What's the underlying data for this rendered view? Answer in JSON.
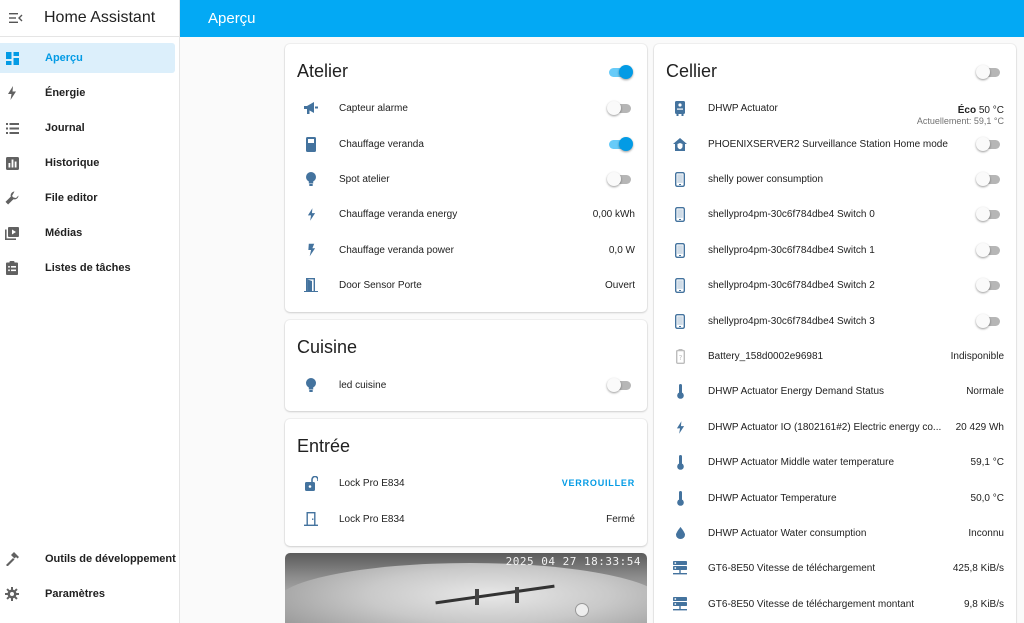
{
  "app": {
    "title": "Home Assistant"
  },
  "header": {
    "title": "Aperçu"
  },
  "sidebar": {
    "items": [
      {
        "label": "Aperçu",
        "icon": "dashboard-icon",
        "active": true
      },
      {
        "label": "Énergie",
        "icon": "lightning-icon"
      },
      {
        "label": "Journal",
        "icon": "list-icon"
      },
      {
        "label": "Historique",
        "icon": "chart-bar-icon"
      },
      {
        "label": "File editor",
        "icon": "wrench-icon"
      },
      {
        "label": "Médias",
        "icon": "media-play-icon"
      },
      {
        "label": "Listes de tâches",
        "icon": "clipboard-list-icon"
      }
    ],
    "bottom": [
      {
        "label": "Outils de développement",
        "icon": "hammer-icon"
      },
      {
        "label": "Paramètres",
        "icon": "gear-icon"
      }
    ]
  },
  "cards": {
    "atelier": {
      "title": "Atelier",
      "toggle_on": true,
      "rows": [
        {
          "name": "Capteur alarme",
          "icon": "bullhorn-icon",
          "toggle": false
        },
        {
          "name": "Chauffage veranda",
          "icon": "heater-icon",
          "toggle": true
        },
        {
          "name": "Spot atelier",
          "icon": "lightbulb-icon",
          "toggle": false
        },
        {
          "name": "Chauffage veranda energy",
          "icon": "lightning-icon",
          "value": "0,00 kWh"
        },
        {
          "name": "Chauffage veranda power",
          "icon": "flash-icon",
          "value": "0,0 W"
        },
        {
          "name": "Door Sensor Porte",
          "icon": "door-open-icon",
          "value": "Ouvert"
        }
      ]
    },
    "cuisine": {
      "title": "Cuisine",
      "rows": [
        {
          "name": "led cuisine",
          "icon": "lightbulb-icon",
          "toggle": false
        }
      ]
    },
    "entree": {
      "title": "Entrée",
      "rows": [
        {
          "name": "Lock Pro E834",
          "icon": "lock-open-icon",
          "action": "VERROUILLER"
        },
        {
          "name": "Lock Pro E834",
          "icon": "door-closed-icon",
          "value": "Fermé"
        }
      ]
    },
    "camera": {
      "timestamp": "2025 04 27 18:33:54"
    },
    "cellier": {
      "title": "Cellier",
      "toggle_on": false,
      "rows": [
        {
          "name": "DHWP Actuator",
          "icon": "water-heater-icon",
          "value_strong": "Éco",
          "value": "50 °C",
          "sub": "Actuellement: 59,1 °C"
        },
        {
          "name": "PHOENIXSERVER2 Surveillance Station Home mode",
          "icon": "home-shield-icon",
          "toggle": false
        },
        {
          "name": "shelly power consumption",
          "icon": "cellphone-icon",
          "toggle": false
        },
        {
          "name": "shellypro4pm-30c6f784dbe4 Switch 0",
          "icon": "cellphone-icon",
          "toggle": false
        },
        {
          "name": "shellypro4pm-30c6f784dbe4 Switch 1",
          "icon": "cellphone-icon",
          "toggle": false
        },
        {
          "name": "shellypro4pm-30c6f784dbe4 Switch 2",
          "icon": "cellphone-icon",
          "toggle": false
        },
        {
          "name": "shellypro4pm-30c6f784dbe4 Switch 3",
          "icon": "cellphone-icon",
          "toggle": false
        },
        {
          "name": "Battery_158d0002e96981",
          "icon": "battery-unknown-icon",
          "value": "Indisponible"
        },
        {
          "name": "DHWP Actuator Energy Demand Status",
          "icon": "thermometer-icon",
          "value": "Normale"
        },
        {
          "name": "DHWP Actuator IO (1802161#2) Electric energy co...",
          "icon": "lightning-icon",
          "value": "20 429 Wh"
        },
        {
          "name": "DHWP Actuator Middle water temperature",
          "icon": "thermometer-icon",
          "value": "59,1 °C"
        },
        {
          "name": "DHWP Actuator Temperature",
          "icon": "thermometer-icon",
          "value": "50,0 °C"
        },
        {
          "name": "DHWP Actuator Water consumption",
          "icon": "water-drop-icon",
          "value": "Inconnu"
        },
        {
          "name": "GT6-8E50 Vitesse de téléchargement",
          "icon": "server-network-icon",
          "value": "425,8 KiB/s"
        },
        {
          "name": "GT6-8E50 Vitesse de téléchargement montant",
          "icon": "server-network-icon",
          "value": "9,8 KiB/s"
        }
      ]
    }
  },
  "colors": {
    "accent": "#03a9f4",
    "icon": "#44739e"
  }
}
